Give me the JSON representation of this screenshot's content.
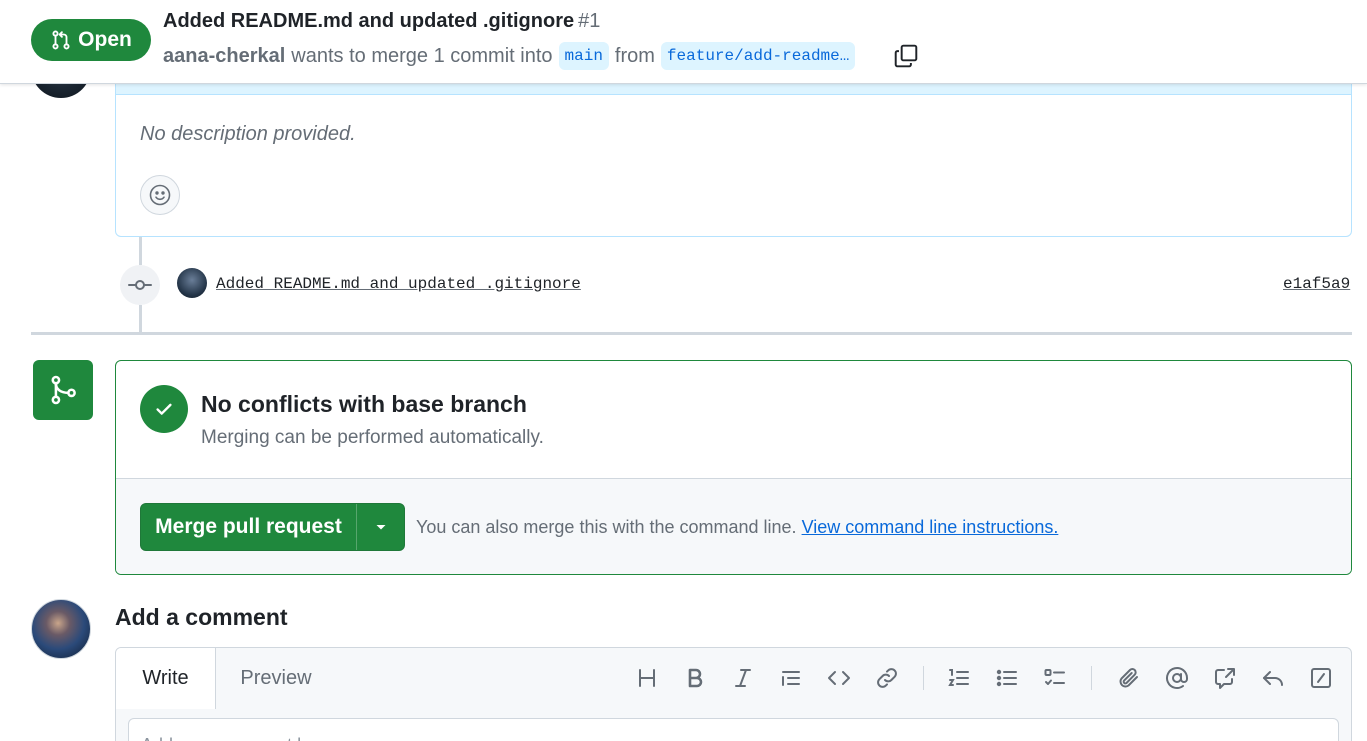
{
  "header": {
    "state": "Open",
    "title": "Added README.md and updated .gitignore",
    "number": "#1",
    "author": "aana-cherkal",
    "merge_text": "wants to merge 1 commit into",
    "base_branch": "main",
    "from_text": "from",
    "head_branch": "feature/add-readme…"
  },
  "description": {
    "text": "No description provided."
  },
  "commit": {
    "message": "Added README.md and updated .gitignore",
    "sha": "e1af5a9"
  },
  "merge": {
    "heading": "No conflicts with base branch",
    "subtext": "Merging can be performed automatically.",
    "button_label": "Merge pull request",
    "hint": "You can also merge this with the command line.",
    "hint_link": "View command line instructions."
  },
  "comment": {
    "heading": "Add a comment",
    "tab_write": "Write",
    "tab_preview": "Preview",
    "placeholder": "Add your comment here..."
  },
  "colors": {
    "success": "#1f883d",
    "accent": "#0969da",
    "muted": "#656d76"
  }
}
